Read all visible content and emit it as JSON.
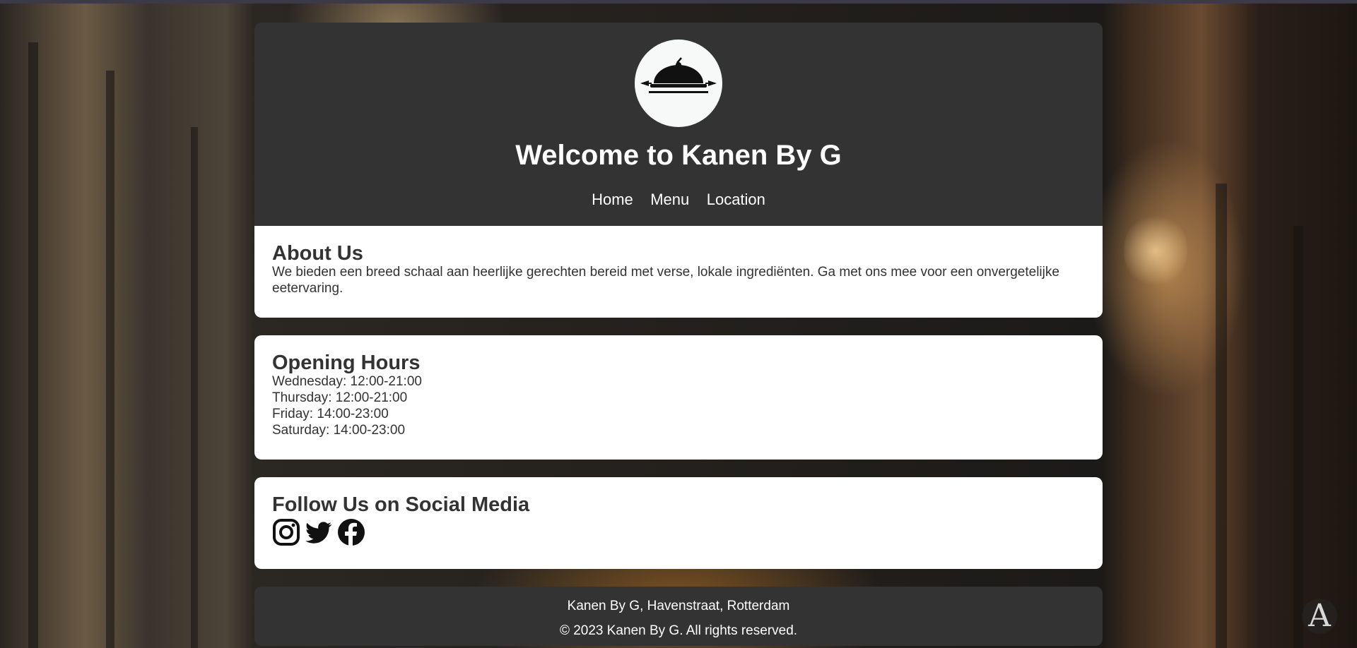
{
  "header": {
    "logo_icon": "serving-cloche-icon",
    "title": "Welcome to Kanen By G",
    "nav": [
      {
        "label": "Home"
      },
      {
        "label": "Menu"
      },
      {
        "label": "Location"
      }
    ]
  },
  "about": {
    "heading": "About Us",
    "text": "We bieden een breed schaal aan heerlijke gerechten bereid met verse, lokale ingrediënten. Ga met ons mee voor een onvergetelijke eetervaring."
  },
  "hours": {
    "heading": "Opening Hours",
    "lines": [
      "Wednesday: 12:00-21:00",
      "Thursday: 12:00-21:00",
      "Friday: 14:00-23:00",
      "Saturday: 14:00-23:00"
    ]
  },
  "social": {
    "heading": "Follow Us on Social Media",
    "icons": [
      "instagram-icon",
      "twitter-icon",
      "facebook-icon"
    ]
  },
  "footer": {
    "address": "Kanen By G, Havenstraat, Rotterdam",
    "copyright": "© 2023 Kanen By G. All rights reserved."
  },
  "colors": {
    "panel_dark": "#333333",
    "card_bg": "#ffffff",
    "text_dark": "#333333"
  }
}
